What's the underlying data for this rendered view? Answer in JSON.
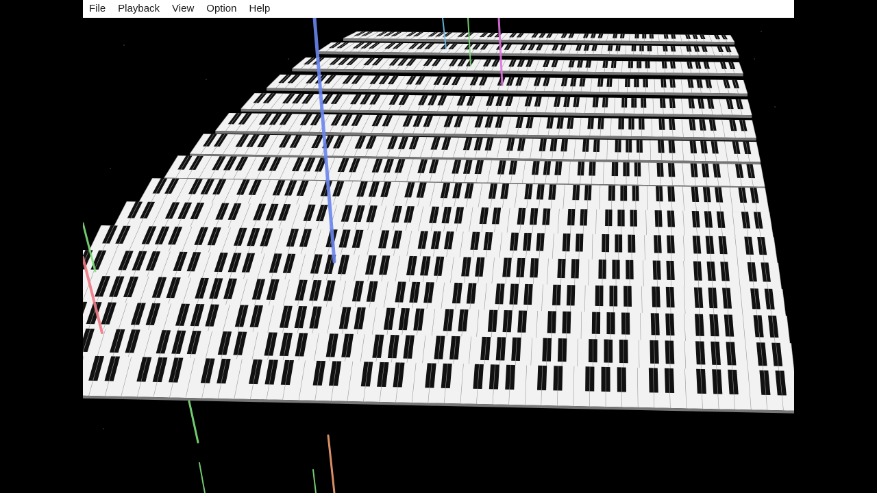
{
  "window": {
    "menu": [
      {
        "id": "file",
        "label": "File"
      },
      {
        "id": "playback",
        "label": "Playback"
      },
      {
        "id": "view",
        "label": "View"
      },
      {
        "id": "option",
        "label": "Option"
      },
      {
        "id": "help",
        "label": "Help"
      }
    ]
  },
  "visualizer": {
    "keyboard_count": 16,
    "background_color": "#000000",
    "white_key_color": "#f2f2f2",
    "black_key_color": "#111111",
    "note_colors": [
      "#6a86f0",
      "#7fe07a",
      "#f07a86",
      "#f0a070",
      "#e070e0",
      "#70c0f0"
    ]
  }
}
